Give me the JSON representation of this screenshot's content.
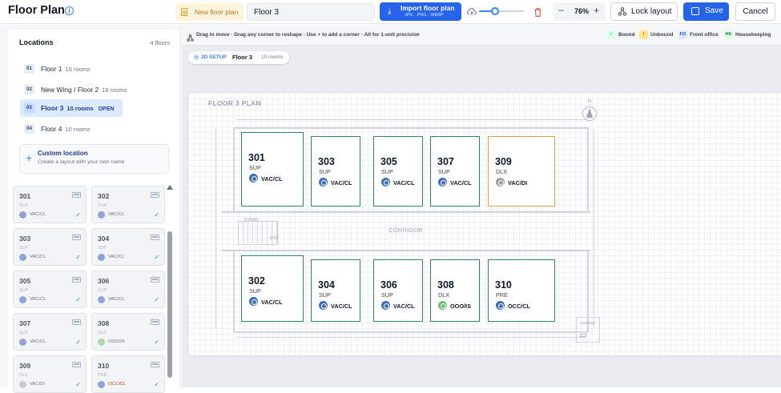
{
  "header": {
    "title": "Floor Plan",
    "new_plan_label": "New floor plan",
    "floor_name_value": "Floor 3",
    "import_label": "Import floor plan",
    "import_formats": "JPG · PNG · WEBP",
    "opacity_fraction": 0.35,
    "zoom_value": "76%",
    "zoom_minus": "−",
    "zoom_plus": "+",
    "lock_label": "Lock layout",
    "save_label": "Save",
    "cancel_label": "Cancel"
  },
  "sidebar": {
    "locations_title": "Locations",
    "floors_count": "4 floors",
    "items": [
      {
        "num": "01",
        "name": "Floor 1",
        "rooms": "10 rooms",
        "active": false,
        "badge": ""
      },
      {
        "num": "02",
        "name": "New Wing / Floor 2",
        "rooms": "16 rooms",
        "active": false,
        "badge": ""
      },
      {
        "num": "03",
        "name": "Floor 3",
        "rooms": "10 rooms",
        "active": true,
        "badge": "OPEN"
      },
      {
        "num": "04",
        "name": "Floor 4",
        "rooms": "10 rooms",
        "active": false,
        "badge": ""
      }
    ],
    "custom_title": "Custom location",
    "custom_sub": "Create a layout with your own name",
    "room_cards": [
      {
        "num": "301",
        "type": "SUP",
        "status": "VAC/CL",
        "status_color": "blue"
      },
      {
        "num": "302",
        "type": "SUP",
        "status": "VAC/CL",
        "status_color": "blue"
      },
      {
        "num": "303",
        "type": "SUP",
        "status": "VAC/CL",
        "status_color": "blue"
      },
      {
        "num": "304",
        "type": "SUP",
        "status": "VAC/CL",
        "status_color": "blue"
      },
      {
        "num": "305",
        "type": "SUP",
        "status": "VAC/CL",
        "status_color": "blue"
      },
      {
        "num": "306",
        "type": "SUP",
        "status": "VAC/CL",
        "status_color": "blue"
      },
      {
        "num": "307",
        "type": "SUP",
        "status": "VAC/CL",
        "status_color": "blue"
      },
      {
        "num": "308",
        "type": "DLX",
        "status": "OOO/IS",
        "status_color": "green"
      },
      {
        "num": "309",
        "type": "DLX",
        "status": "VAC/DI",
        "status_color": "grey"
      },
      {
        "num": "310",
        "type": "PRE",
        "status": "OCC/CL",
        "status_color": "blue",
        "status_text_color": "#c2410c"
      }
    ]
  },
  "canvas": {
    "hint": "Drag to move · Drag any corner to reshape · Use + to add a corner · Alt for 1-unit precision",
    "legend": [
      {
        "badge": "✓",
        "label": "Bound",
        "bg": "#dcfce7",
        "fg": "#16a34a"
      },
      {
        "badge": "!",
        "label": "Unbound",
        "bg": "#fde68a",
        "fg": "#b45309"
      },
      {
        "badge": "FO",
        "label": "Front office",
        "bg": "#dbeafe",
        "fg": "#1d4ed8"
      },
      {
        "badge": "HK",
        "label": "Housekeeping",
        "bg": "#dcfce7",
        "fg": "#15803d"
      }
    ],
    "mode_label": "2D SETUP",
    "floor_label": "Floor 3",
    "rooms_label": "10 rooms",
    "plan_title": "FLOOR 3 PLAN",
    "north_label": "N",
    "corridor_label": "CORRIDOR",
    "stairs_label": "STAIRS",
    "exit_label": "EXIT",
    "legend_box_label": "LEGEND",
    "rooms": [
      {
        "num": "301",
        "type": "SUP",
        "status": "VAC/CL",
        "icon": "blue",
        "border": "green"
      },
      {
        "num": "303",
        "type": "SUP",
        "status": "VAC/CL",
        "icon": "blue",
        "border": "green"
      },
      {
        "num": "305",
        "type": "SUP",
        "status": "VAC/CL",
        "icon": "blue",
        "border": "green"
      },
      {
        "num": "307",
        "type": "SUP",
        "status": "VAC/CL",
        "icon": "blue",
        "border": "green"
      },
      {
        "num": "309",
        "type": "DLX",
        "status": "VAC/DI",
        "icon": "grey",
        "border": "amber"
      },
      {
        "num": "302",
        "type": "SUP",
        "status": "VAC/CL",
        "icon": "blue",
        "border": "green"
      },
      {
        "num": "304",
        "type": "SUP",
        "status": "VAC/CL",
        "icon": "blue",
        "border": "green"
      },
      {
        "num": "306",
        "type": "SUP",
        "status": "VAC/CL",
        "icon": "blue",
        "border": "green"
      },
      {
        "num": "308",
        "type": "DLX",
        "status": "OOO/IS",
        "icon": "green",
        "border": "green"
      },
      {
        "num": "310",
        "type": "PRE",
        "status": "OCC/CL",
        "icon": "blue",
        "border": "green"
      }
    ]
  }
}
